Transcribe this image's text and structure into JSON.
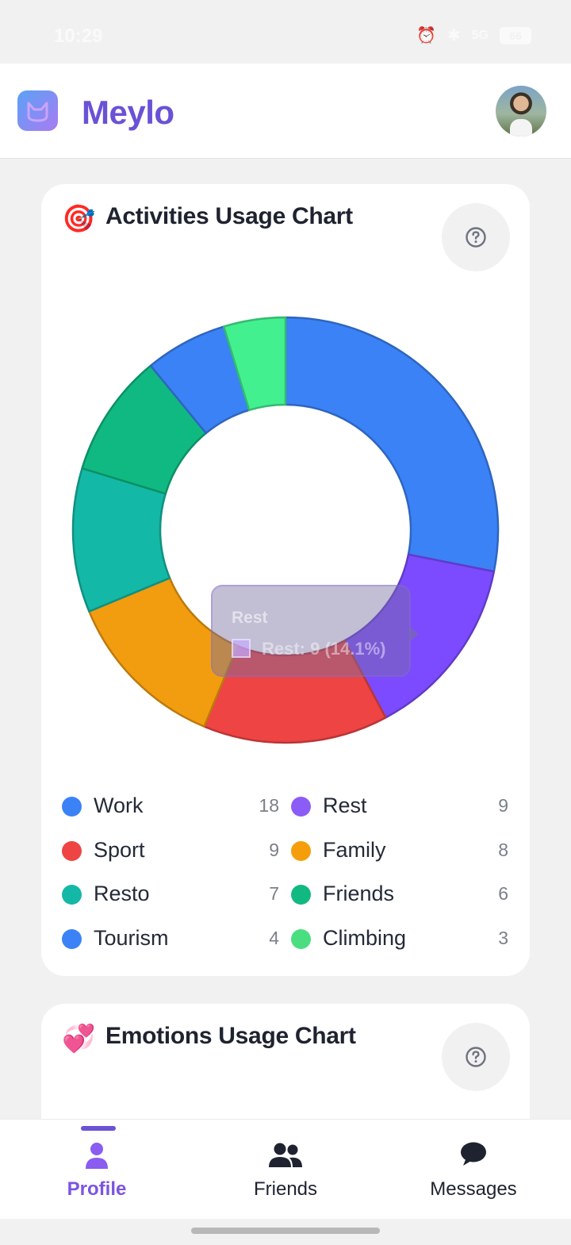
{
  "status_bar": {
    "time": "10:29",
    "battery": "66",
    "signal_label": "5G"
  },
  "app": {
    "name": "Meylo"
  },
  "activities_card": {
    "emoji": "🎯",
    "title": "Activities Usage Chart",
    "help_icon": "question-circle-icon"
  },
  "emotions_card": {
    "emoji": "💞",
    "title": "Emotions Usage Chart",
    "help_icon": "question-circle-icon"
  },
  "tooltip": {
    "title": "Rest",
    "text": "Rest: 9 (14.1%)"
  },
  "chart_data": {
    "type": "pie",
    "donut": true,
    "title": "Activities Usage Chart",
    "categories": [
      "Work",
      "Rest",
      "Sport",
      "Family",
      "Resto",
      "Friends",
      "Tourism",
      "Climbing"
    ],
    "values": [
      18,
      9,
      9,
      8,
      7,
      6,
      4,
      3
    ],
    "colors": [
      "#3b82f6",
      "#8b5cf6",
      "#ef4444",
      "#f59e0b",
      "#14b8a6",
      "#10b981",
      "#3b82f6",
      "#4ade80"
    ],
    "slice_colors": [
      "#3b82f6",
      "#7c4bff",
      "#ef4444",
      "#f29d0f",
      "#14b8a6",
      "#10b981",
      "#3b82f6",
      "#42f08f"
    ],
    "legend_placement": "bottom"
  },
  "legend": [
    {
      "label": "Work",
      "count": "18",
      "color": "#3b82f6"
    },
    {
      "label": "Rest",
      "count": "9",
      "color": "#8b5cf6"
    },
    {
      "label": "Sport",
      "count": "9",
      "color": "#ef4444"
    },
    {
      "label": "Family",
      "count": "8",
      "color": "#f59e0b"
    },
    {
      "label": "Resto",
      "count": "7",
      "color": "#14b8a6"
    },
    {
      "label": "Friends",
      "count": "6",
      "color": "#10b981"
    },
    {
      "label": "Tourism",
      "count": "4",
      "color": "#3b82f6"
    },
    {
      "label": "Climbing",
      "count": "3",
      "color": "#4ade80"
    }
  ],
  "bottom_nav": [
    {
      "label": "Profile",
      "icon": "user-icon",
      "active": true
    },
    {
      "label": "Friends",
      "icon": "users-icon",
      "active": false
    },
    {
      "label": "Messages",
      "icon": "chat-bubble-icon",
      "active": false
    }
  ],
  "colors": {
    "brand": "#6a52d6",
    "active_nav": "#7b55e0",
    "background": "#f1f1f1"
  }
}
